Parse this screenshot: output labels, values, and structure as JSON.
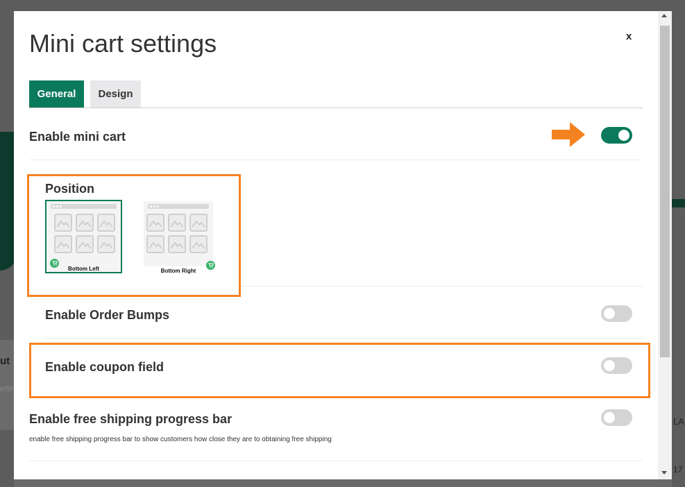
{
  "modal": {
    "title": "Mini cart settings",
    "close_label": "x"
  },
  "tabs": [
    {
      "label": "General",
      "active": true
    },
    {
      "label": "Design",
      "active": false
    }
  ],
  "settings": {
    "enable_mini_cart": {
      "label": "Enable mini cart",
      "enabled": true
    },
    "position": {
      "label": "Position",
      "options": [
        {
          "label": "Bottom Left",
          "selected": true
        },
        {
          "label": "Bottom Right",
          "selected": false
        }
      ]
    },
    "enable_order_bumps": {
      "label": "Enable Order Bumps",
      "enabled": false
    },
    "enable_coupon_field": {
      "label": "Enable coupon field",
      "enabled": false
    },
    "enable_free_shipping": {
      "label": "Enable free shipping progress bar",
      "description": "enable free shipping progress bar to show customers how close they are to obtaining free shipping",
      "enabled": false
    }
  },
  "background": {
    "text_left_1": "ut",
    "text_left_2": "ettin",
    "text_right_1": "LA",
    "text_right_2": "17"
  },
  "colors": {
    "accent": "#0b7a5c",
    "highlight": "#f58220",
    "toggle_off": "#d4d4d4"
  }
}
